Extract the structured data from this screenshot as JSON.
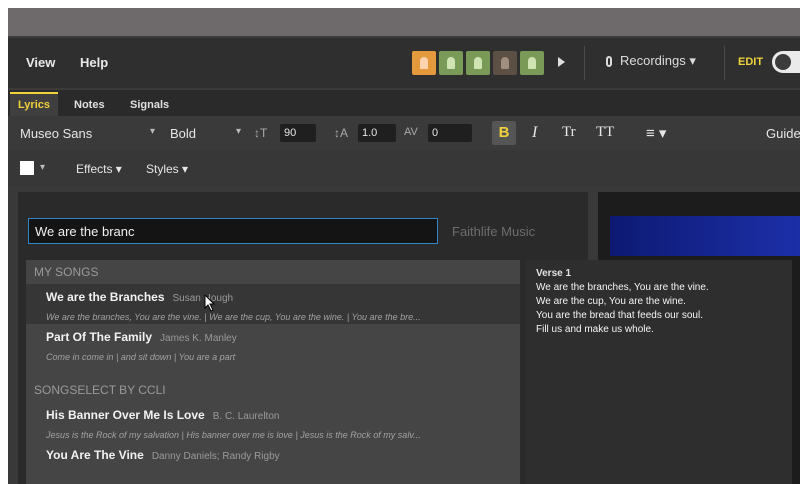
{
  "menu": {
    "view": "View",
    "help": "Help",
    "recordings": "Recordings ▾",
    "edit": "EDIT"
  },
  "tabs": [
    "Lyrics",
    "Notes",
    "Signals"
  ],
  "fontbar": {
    "font": "Museo Sans",
    "weight": "Bold",
    "size": "90",
    "spacing": "1.0",
    "tracking": "0",
    "guide": "Guide"
  },
  "stylebar": {
    "effects": "Effects ▾",
    "styles": "Styles ▾"
  },
  "search": {
    "value": "We are the branc",
    "source": "Faithlife Music"
  },
  "sections": [
    "MY SONGS",
    "SONGSELECT BY CCLI"
  ],
  "songs": [
    {
      "title": "We are the Branches",
      "author": "Susan Hough",
      "lyrics": "We are the branches, You are the vine. | We are the cup, You are the wine. | You are the bre..."
    },
    {
      "title": "Part Of The Family",
      "author": "James K. Manley",
      "lyrics": "Come in come in | and sit down | You are a part"
    },
    {
      "title": "His Banner Over Me Is Love",
      "author": "B. C. Laurelton",
      "lyrics": "Jesus is the Rock of my salvation | His banner over me is love | Jesus is the Rock of my salv..."
    },
    {
      "title": "You Are The Vine",
      "author": "Danny Daniels; Randy Rigby",
      "lyrics": ""
    }
  ],
  "preview": {
    "heading": "Verse 1",
    "lines": [
      "We are the branches, You are the vine.",
      "We are the cup, You are the wine.",
      "You are the bread that feeds our soul.",
      "Fill us and make us whole."
    ]
  },
  "colors": {
    "accent": "#f2d13a",
    "search_border": "#2f86c9"
  },
  "icons": {
    "avatar": "person-icon",
    "mic": "mic-icon",
    "cursor": "mouse-cursor-icon"
  }
}
